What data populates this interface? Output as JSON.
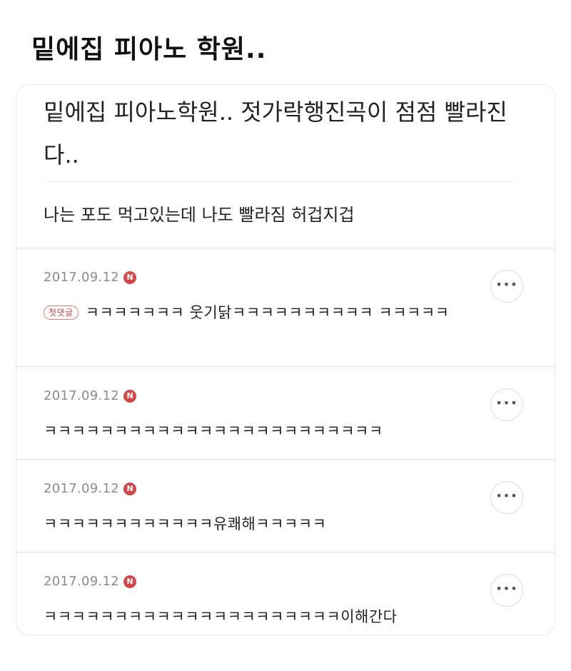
{
  "header": {
    "title": "밑에집 피아노 학원.."
  },
  "post": {
    "title": "밑에집 피아노학원.. 젓가락행진곡이 점점 빨라진다..",
    "body": "나는 포도 먹고있는데 나도 빨라짐 허겁지겁"
  },
  "comments": [
    {
      "date": "2017.09.12",
      "badge": "N",
      "first_label": "첫댓글",
      "text": "ㅋㅋㅋㅋㅋㅋㅋ 웃기닭ㅋㅋㅋㅋㅋㅋㅋㅋㅋㅋ ㅋㅋㅋㅋㅋ",
      "more": "•••"
    },
    {
      "date": "2017.09.12",
      "badge": "N",
      "text": "ㅋㅋㅋㅋㅋㅋㅋㅋㅋㅋㅋㅋㅋㅋㅋㅋㅋㅋㅋㅋㅋㅋㅋㅋ",
      "more": "•••"
    },
    {
      "date": "2017.09.12",
      "badge": "N",
      "text": "ㅋㅋㅋㅋㅋㅋㅋㅋㅋㅋㅋㅋ유쾌해ㅋㅋㅋㅋㅋ",
      "more": "•••"
    },
    {
      "date": "2017.09.12",
      "badge": "N",
      "text": "ㅋㅋㅋㅋㅋㅋㅋㅋㅋㅋㅋㅋㅋㅋㅋㅋㅋㅋㅋㅋㅋ이해간다",
      "more": "•••"
    }
  ],
  "colors": {
    "badge": "#d24848",
    "date": "#8c8c8c",
    "divider": "#e2e2e2"
  }
}
